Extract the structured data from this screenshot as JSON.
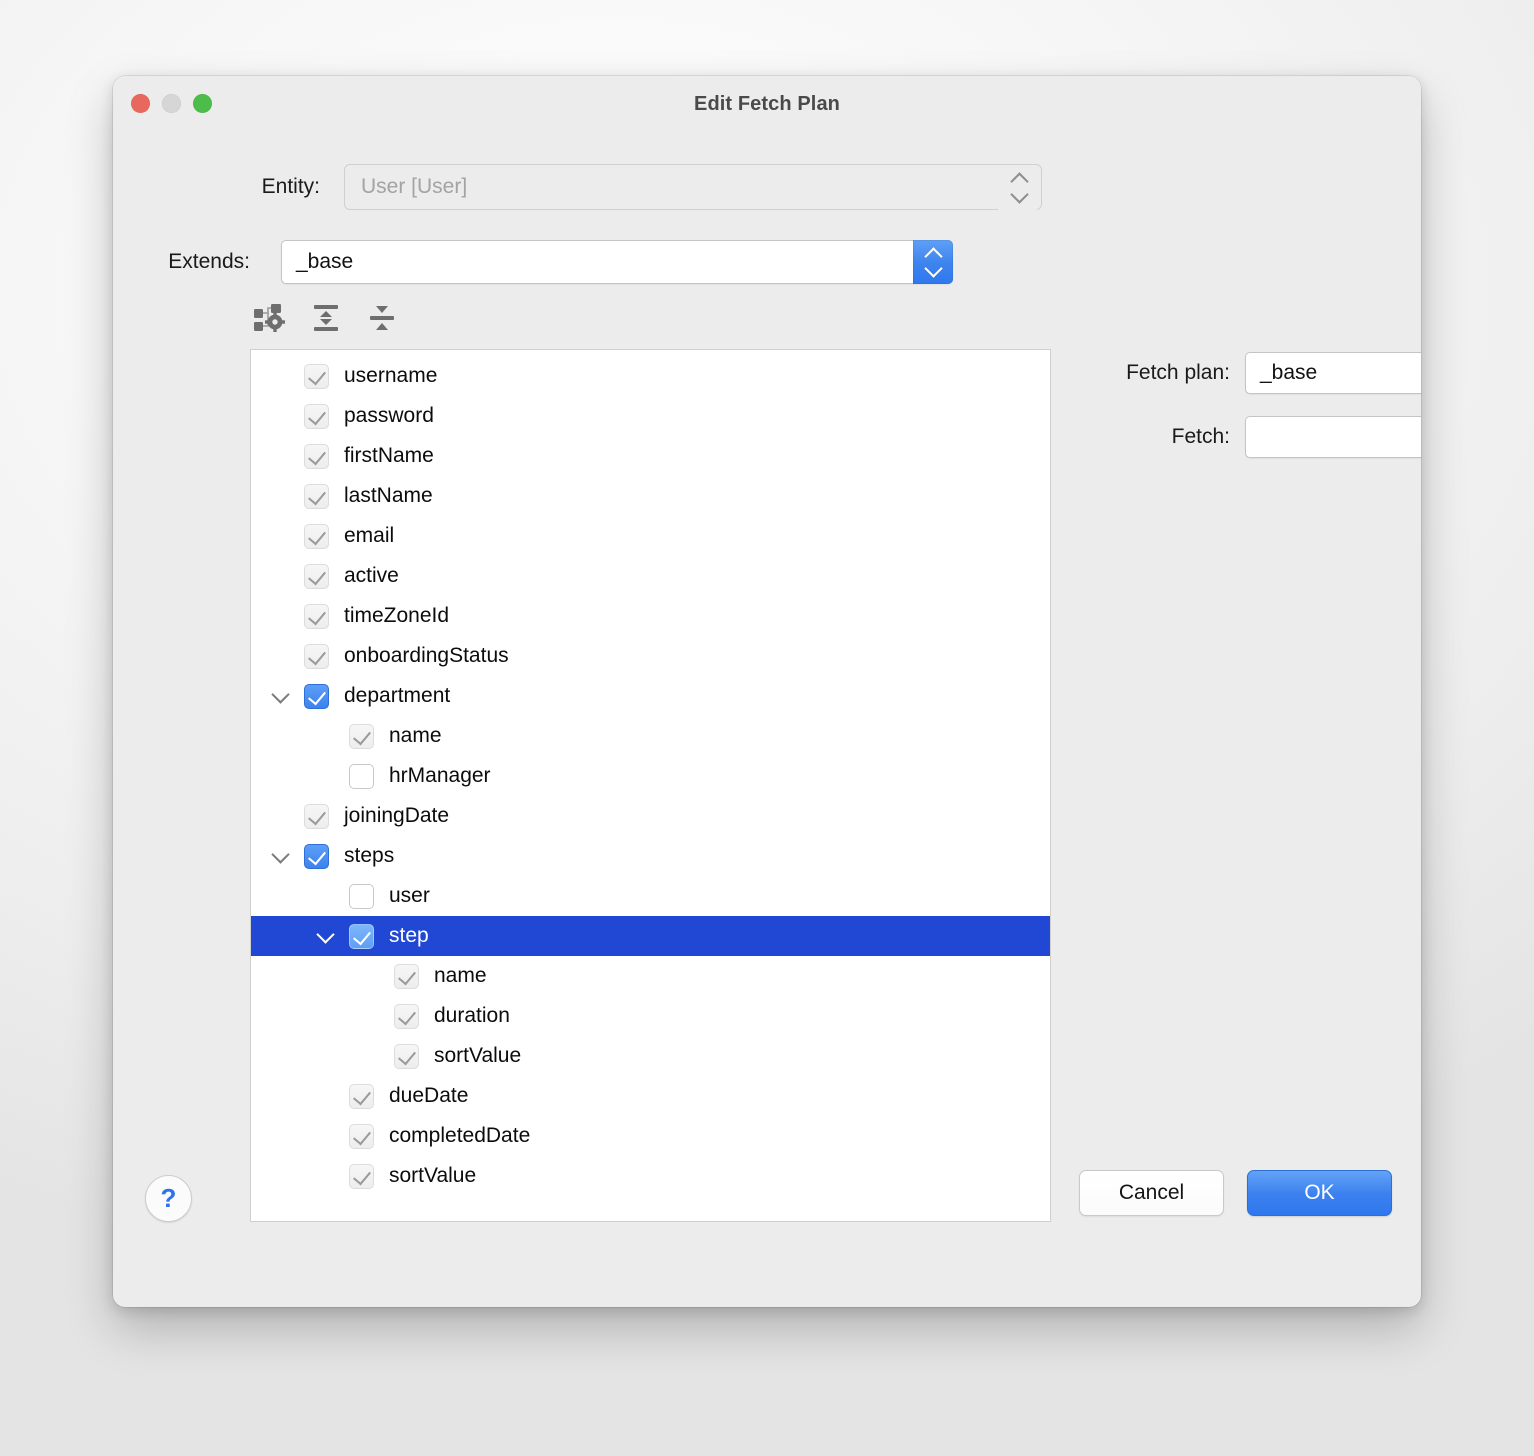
{
  "window": {
    "title": "Edit Fetch Plan",
    "traffic_lights": [
      {
        "name": "close",
        "color": "#e8685d"
      },
      {
        "name": "minimize",
        "color": "#d6d6d6"
      },
      {
        "name": "zoom",
        "color": "#4cbd4a"
      }
    ]
  },
  "form": {
    "entity": {
      "label": "Entity:",
      "value": "User [User]",
      "enabled": false
    },
    "extends": {
      "label": "Extends:",
      "value": "_base",
      "enabled": true
    }
  },
  "toolbar": {
    "buttons": [
      {
        "name": "edit-structure-icon",
        "tooltip": "Edit structure"
      },
      {
        "name": "expand-all-icon",
        "tooltip": "Expand all"
      },
      {
        "name": "collapse-all-icon",
        "tooltip": "Collapse all"
      }
    ]
  },
  "tree": {
    "items": [
      {
        "label": "username",
        "depth": 0,
        "check": "inherited",
        "disclosure": "none",
        "selected": false
      },
      {
        "label": "password",
        "depth": 0,
        "check": "inherited",
        "disclosure": "none",
        "selected": false
      },
      {
        "label": "firstName",
        "depth": 0,
        "check": "inherited",
        "disclosure": "none",
        "selected": false
      },
      {
        "label": "lastName",
        "depth": 0,
        "check": "inherited",
        "disclosure": "none",
        "selected": false
      },
      {
        "label": "email",
        "depth": 0,
        "check": "inherited",
        "disclosure": "none",
        "selected": false
      },
      {
        "label": "active",
        "depth": 0,
        "check": "inherited",
        "disclosure": "none",
        "selected": false
      },
      {
        "label": "timeZoneId",
        "depth": 0,
        "check": "inherited",
        "disclosure": "none",
        "selected": false
      },
      {
        "label": "onboardingStatus",
        "depth": 0,
        "check": "inherited",
        "disclosure": "none",
        "selected": false
      },
      {
        "label": "department",
        "depth": 0,
        "check": "checked",
        "disclosure": "expanded",
        "selected": false
      },
      {
        "label": "name",
        "depth": 1,
        "check": "inherited",
        "disclosure": "none",
        "selected": false
      },
      {
        "label": "hrManager",
        "depth": 1,
        "check": "unchecked",
        "disclosure": "none",
        "selected": false
      },
      {
        "label": "joiningDate",
        "depth": 0,
        "check": "inherited",
        "disclosure": "none",
        "selected": false
      },
      {
        "label": "steps",
        "depth": 0,
        "check": "checked",
        "disclosure": "expanded",
        "selected": false
      },
      {
        "label": "user",
        "depth": 1,
        "check": "unchecked",
        "disclosure": "none",
        "selected": false
      },
      {
        "label": "step",
        "depth": 1,
        "check": "checked",
        "disclosure": "expanded",
        "selected": true
      },
      {
        "label": "name",
        "depth": 2,
        "check": "inherited",
        "disclosure": "none",
        "selected": false
      },
      {
        "label": "duration",
        "depth": 2,
        "check": "inherited",
        "disclosure": "none",
        "selected": false
      },
      {
        "label": "sortValue",
        "depth": 2,
        "check": "inherited",
        "disclosure": "none",
        "selected": false
      },
      {
        "label": "dueDate",
        "depth": 1,
        "check": "inherited",
        "disclosure": "none",
        "selected": false
      },
      {
        "label": "completedDate",
        "depth": 1,
        "check": "inherited",
        "disclosure": "none",
        "selected": false
      },
      {
        "label": "sortValue",
        "depth": 1,
        "check": "inherited",
        "disclosure": "none",
        "selected": false
      }
    ]
  },
  "options": {
    "fetch_plan": {
      "label": "Fetch plan:",
      "value": "_base"
    },
    "fetch": {
      "label": "Fetch:",
      "value": ""
    }
  },
  "footer": {
    "help_label": "?",
    "cancel_label": "Cancel",
    "ok_label": "OK"
  },
  "colors": {
    "selection": "#2148d4",
    "accent": "#3d82ef",
    "window_bg": "#ececec",
    "panel_bg": "#ffffff"
  }
}
